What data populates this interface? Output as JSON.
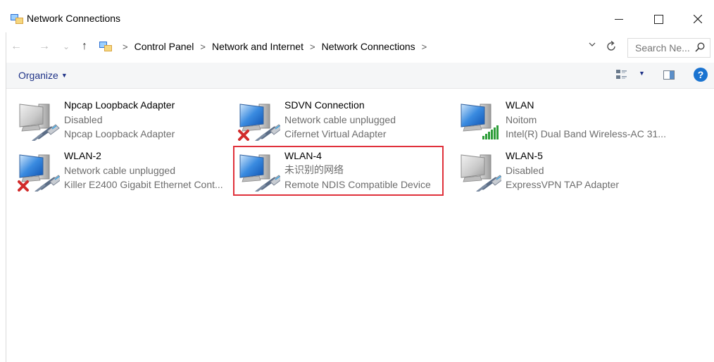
{
  "window": {
    "title": "Network Connections"
  },
  "address": {
    "crumbs": [
      "Control Panel",
      "Network and Internet",
      "Network Connections"
    ],
    "search_placeholder": "Search Ne..."
  },
  "toolbar": {
    "organize_label": "Organize"
  },
  "connections": [
    {
      "name": "Npcap Loopback Adapter",
      "status": "Disabled",
      "device": "Npcap Loopback Adapter",
      "state_icon": "none"
    },
    {
      "name": "SDVN Connection",
      "status": "Network cable unplugged",
      "device": "Cifernet Virtual Adapter",
      "state_icon": "error-x-icon"
    },
    {
      "name": "WLAN",
      "status": "Noitom",
      "device": "Intel(R) Dual Band Wireless-AC 31...",
      "state_icon": "signal-bars-icon"
    },
    {
      "name": "WLAN-2",
      "status": "Network cable unplugged",
      "device": "Killer E2400 Gigabit Ethernet Cont...",
      "state_icon": "error-x-icon"
    },
    {
      "name": "WLAN-4",
      "status": "未识别的网络",
      "device": "Remote NDIS Compatible Device",
      "state_icon": "none",
      "highlighted": true
    },
    {
      "name": "WLAN-5",
      "status": "Disabled",
      "device": "ExpressVPN TAP Adapter",
      "state_icon": "none"
    }
  ],
  "colors": {
    "highlight_border": "#e0313b",
    "organize_text": "#1e3287",
    "secondary_text": "#6d6d6d",
    "error_x": "#d12b2b",
    "signal": "#2e9e3a"
  }
}
